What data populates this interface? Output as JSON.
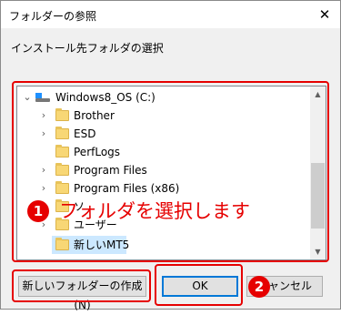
{
  "window": {
    "title": "フォルダーの参照",
    "close_glyph": "✕"
  },
  "instruction": "インストール先フォルダの選択",
  "tree": {
    "root": {
      "label": "Windows8_OS (C:)",
      "expanded_glyph": "⌄"
    },
    "items": [
      {
        "label": "Brother",
        "chevron": "›"
      },
      {
        "label": "ESD",
        "chevron": "›"
      },
      {
        "label": "PerfLogs",
        "chevron": ""
      },
      {
        "label": "Program Files",
        "chevron": "›"
      },
      {
        "label": "Program Files (x86)",
        "chevron": "›"
      },
      {
        "label": "ソ",
        "chevron": ""
      },
      {
        "label": "ユーザー",
        "chevron": "›"
      },
      {
        "label": "新しいMT5",
        "chevron": "",
        "selected": true
      }
    ]
  },
  "scrollbar": {
    "up_glyph": "▲",
    "down_glyph": "▼"
  },
  "buttons": {
    "new_folder": "新しいフォルダーの作成(N)",
    "ok": "OK",
    "cancel": "キャンセル"
  },
  "annotations": {
    "marker1": "1",
    "marker2": "2",
    "callout_text": "フォルダを選択します",
    "color": "#e60000"
  }
}
